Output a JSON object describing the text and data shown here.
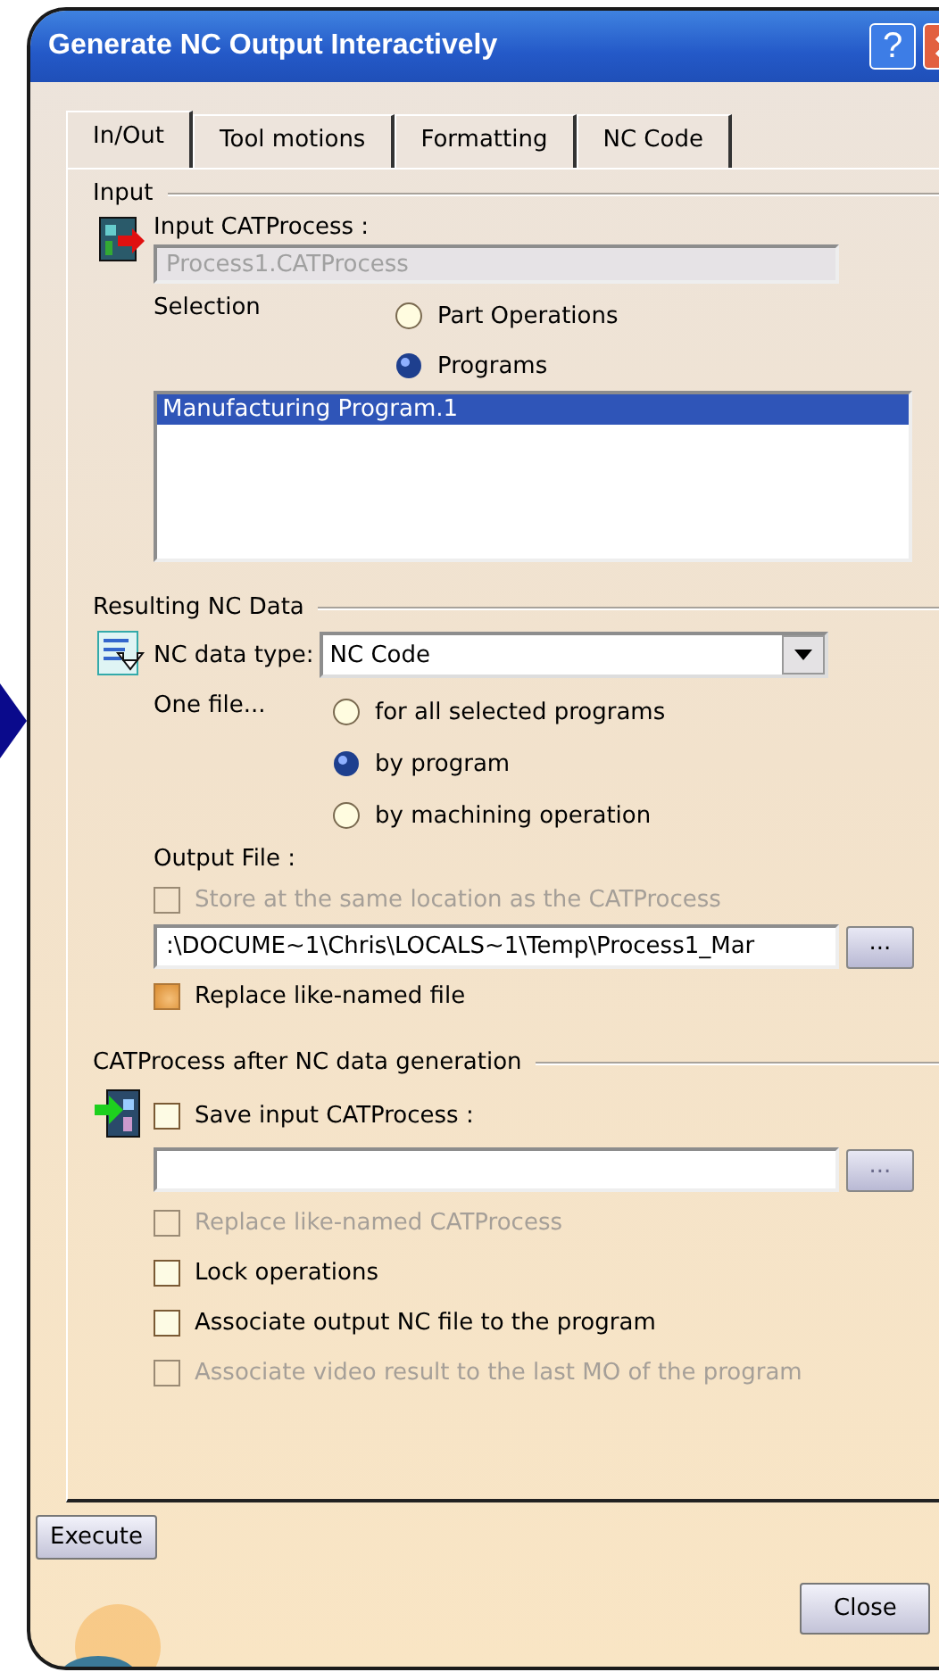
{
  "window": {
    "title": "Generate NC Output Interactively",
    "help_button": "?"
  },
  "tabs": [
    {
      "label": "In/Out",
      "selected": true
    },
    {
      "label": "Tool motions",
      "selected": false
    },
    {
      "label": "Formatting",
      "selected": false
    },
    {
      "label": "NC Code",
      "selected": false
    }
  ],
  "input": {
    "title": "Input",
    "label": "Input CATProcess :",
    "value": "Process1.CATProcess",
    "selection_label": "Selection",
    "options": [
      {
        "label": "Part Operations",
        "selected": false
      },
      {
        "label": "Programs",
        "selected": true
      }
    ],
    "list": [
      {
        "label": "Manufacturing Program.1",
        "selected": true
      }
    ]
  },
  "resulting": {
    "title": "Resulting NC Data",
    "type_label": "NC data type:",
    "type_value": "NC Code",
    "one_file_label": "One file...",
    "options": [
      {
        "label": "for all selected programs",
        "selected": false
      },
      {
        "label": "by program",
        "selected": true
      },
      {
        "label": "by machining operation",
        "selected": false
      }
    ],
    "output_label": "Output File :",
    "store": {
      "label": "Store at the same location as the CATProcess",
      "checked": false,
      "disabled": true
    },
    "path": ":\\DOCUME~1\\Chris\\LOCALS~1\\Temp\\Process1_Mar",
    "browse": "...",
    "replace": {
      "label": "Replace like-named file",
      "checked": true,
      "disabled": false
    }
  },
  "after": {
    "title": "CATProcess after NC data generation",
    "save": {
      "label": "Save input CATProcess :",
      "checked": false,
      "disabled": false
    },
    "browse": "...",
    "checkboxes": [
      {
        "label": "Replace like-named CATProcess",
        "checked": false,
        "disabled": true
      },
      {
        "label": "Lock operations",
        "checked": false,
        "disabled": false
      },
      {
        "label": "Associate output NC file to the program",
        "checked": false,
        "disabled": false
      },
      {
        "label": "Associate video result to the last MO of the program",
        "checked": false,
        "disabled": true
      }
    ]
  },
  "buttons": {
    "execute": "Execute",
    "close": "Close"
  }
}
